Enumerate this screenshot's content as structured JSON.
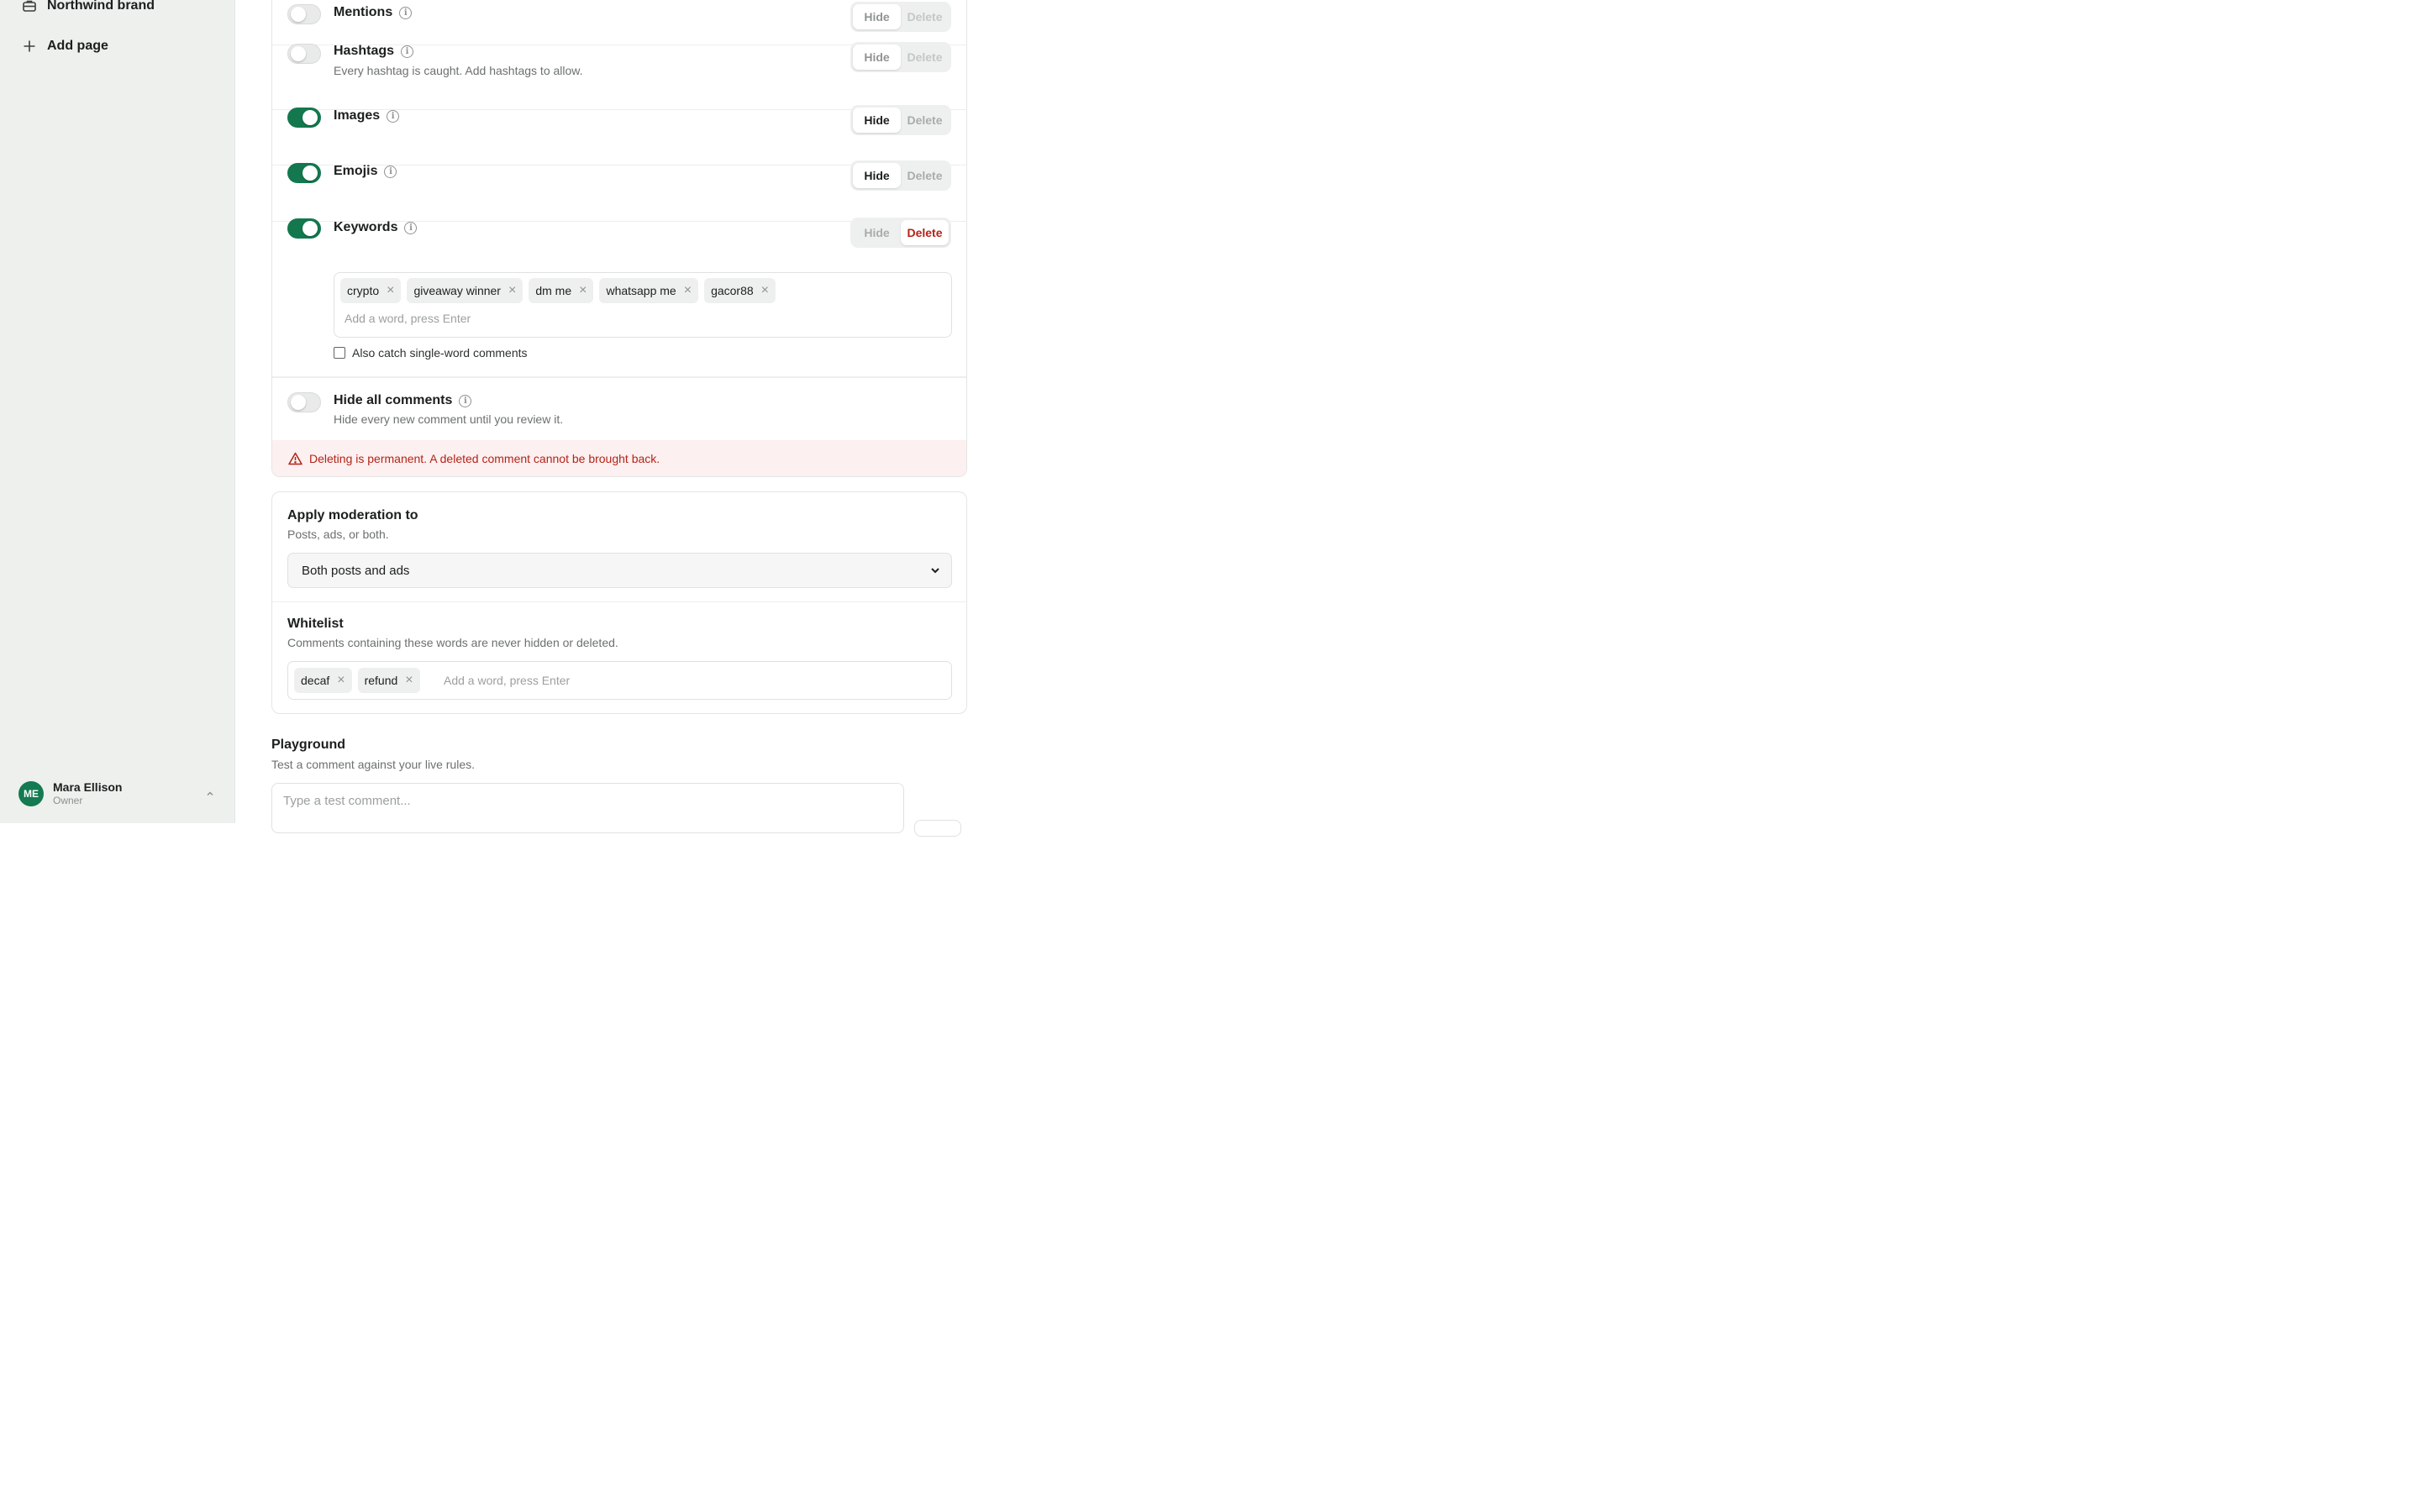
{
  "sidebar": {
    "items": [
      {
        "label": "Northwind brand",
        "icon": "briefcase-icon"
      },
      {
        "label": "Add page",
        "icon": "plus-icon"
      }
    ],
    "user": {
      "initials": "ME",
      "name": "Mara Ellison",
      "role": "Owner"
    }
  },
  "rules": {
    "mentions": {
      "title": "Mentions",
      "enabled": false,
      "hide": "Hide",
      "delete": "Delete"
    },
    "hashtags": {
      "title": "Hashtags",
      "desc": "Every hashtag is caught. Add hashtags to allow.",
      "enabled": false,
      "hide": "Hide",
      "delete": "Delete"
    },
    "images": {
      "title": "Images",
      "enabled": true,
      "hide": "Hide",
      "delete": "Delete",
      "selected": "Hide"
    },
    "emojis": {
      "title": "Emojis",
      "enabled": true,
      "hide": "Hide",
      "delete": "Delete",
      "selected": "Hide"
    },
    "keywords": {
      "title": "Keywords",
      "enabled": true,
      "hide": "Hide",
      "delete": "Delete",
      "selected": "Delete",
      "chips": [
        "crypto",
        "giveaway winner",
        "dm me",
        "whatsapp me",
        "gacor88"
      ],
      "placeholder": "Add a word, press Enter",
      "single_word_label": "Also catch single-word comments"
    },
    "hide_all": {
      "title": "Hide all comments",
      "desc": "Hide every new comment until you review it.",
      "enabled": false
    },
    "warning": "Deleting is permanent. A deleted comment cannot be brought back."
  },
  "apply": {
    "title": "Apply moderation to",
    "desc": "Posts, ads, or both.",
    "selected": "Both posts and ads"
  },
  "whitelist": {
    "title": "Whitelist",
    "desc": "Comments containing these words are never hidden or deleted.",
    "chips": [
      "decaf",
      "refund"
    ],
    "placeholder": "Add a word, press Enter"
  },
  "playground": {
    "title": "Playground",
    "desc": "Test a comment against your live rules.",
    "placeholder": "Type a test comment..."
  },
  "colors": {
    "accent": "#14784f",
    "danger": "#b42318",
    "warning_bg": "#fdf0f0"
  }
}
